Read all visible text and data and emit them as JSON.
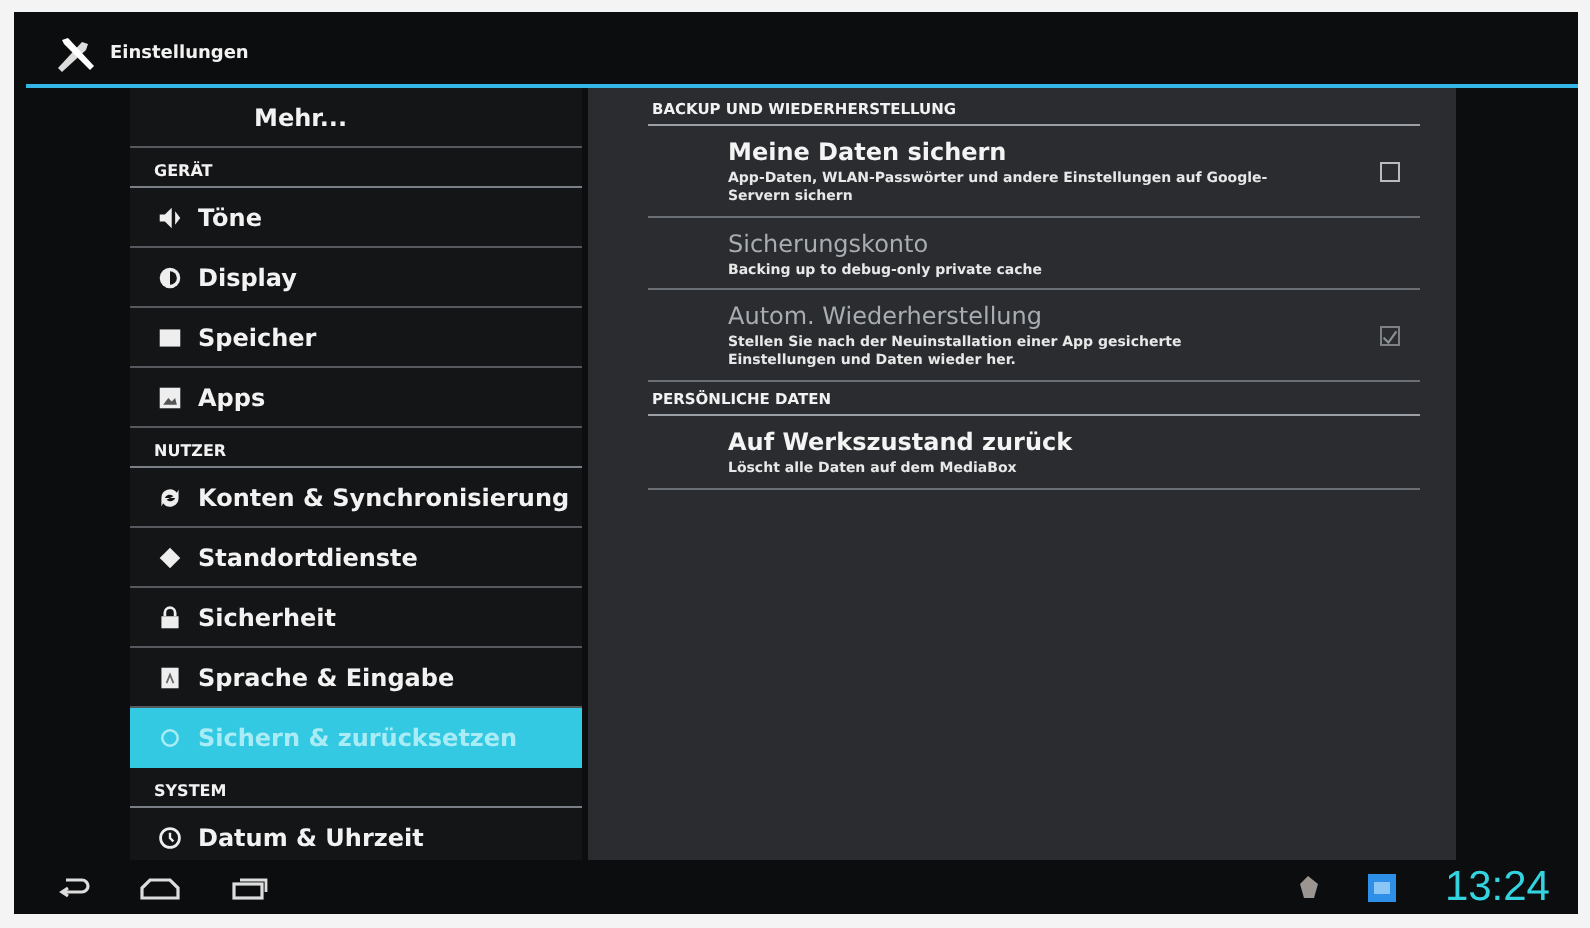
{
  "action_bar": {
    "title": "Einstellungen"
  },
  "sidebar": {
    "items": [
      {
        "kind": "item",
        "label": "Mehr...",
        "selected": false
      },
      {
        "kind": "header",
        "label": "GERÄT"
      },
      {
        "kind": "item",
        "label": "Töne",
        "selected": false
      },
      {
        "kind": "item",
        "label": "Display",
        "selected": false
      },
      {
        "kind": "item",
        "label": "Speicher",
        "selected": false
      },
      {
        "kind": "item",
        "label": "Apps",
        "selected": false
      },
      {
        "kind": "header",
        "label": "NUTZER"
      },
      {
        "kind": "item",
        "label": "Konten & Synchronisierung",
        "selected": false
      },
      {
        "kind": "item",
        "label": "Standortdienste",
        "selected": false
      },
      {
        "kind": "item",
        "label": "Sicherheit",
        "selected": false
      },
      {
        "kind": "item",
        "label": "Sprache & Eingabe",
        "selected": false
      },
      {
        "kind": "item",
        "label": "Sichern & zurücksetzen",
        "selected": true
      },
      {
        "kind": "header",
        "label": "SYSTEM"
      },
      {
        "kind": "item",
        "label": "Datum & Uhrzeit",
        "selected": false
      }
    ]
  },
  "detail": {
    "sections": [
      {
        "header": "BACKUP UND WIEDERHERSTELLUNG",
        "entries": [
          {
            "title": "Meine Daten sichern",
            "summary": "App-Daten, WLAN-Passwörter und andere Einstellungen auf Google-Servern sichern",
            "disabled": false,
            "kind": "checkbox",
            "checked": false
          },
          {
            "title": "Sicherungskonto",
            "summary": "Backing up to debug-only private cache",
            "disabled": true,
            "kind": "plain"
          },
          {
            "title": "Autom. Wiederherstellung",
            "summary": "Stellen Sie nach der Neuinstallation einer App gesicherte Einstellungen und Daten wieder her.",
            "disabled": true,
            "kind": "checkbox",
            "checked": true
          }
        ]
      },
      {
        "header": "PERSÖNLICHE DATEN",
        "entries": [
          {
            "title": "Auf Werkszustand zurück",
            "summary": "Löscht alle Daten auf dem MediaBox",
            "disabled": false,
            "kind": "plain"
          }
        ]
      }
    ]
  },
  "system_bar": {
    "clock": "13:24"
  }
}
